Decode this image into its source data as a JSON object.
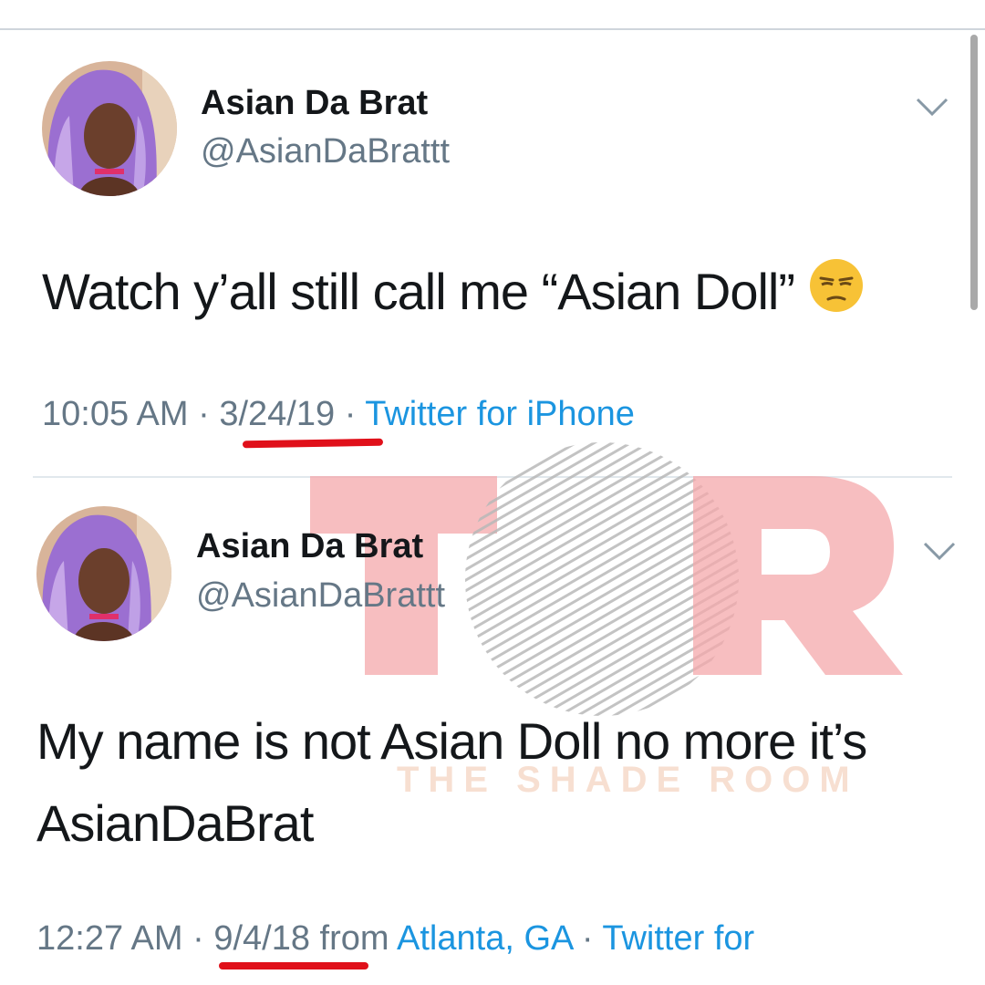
{
  "tweets": [
    {
      "name": "Asian Da Brat",
      "handle": "@AsianDaBrattt",
      "text": "Watch y’all still call me “Asian Doll”",
      "emoji_icon": "unamused-face-icon",
      "time": "10:05 AM",
      "sep1": " · ",
      "date": "3/24/19",
      "sep2": " · ",
      "source": "Twitter for iPhone"
    },
    {
      "name": "Asian Da Brat",
      "handle": "@AsianDaBrattt",
      "text_line1": "My name is not Asian Doll no more it’s",
      "text_line2": "AsianDaBrat",
      "time": "12:27 AM",
      "sep1": " · ",
      "date": "9/4/18",
      "from": " from ",
      "location": "Atlanta, GA",
      "sep2": " · ",
      "source": "Twitter for"
    }
  ],
  "watermark": {
    "logo": "TSR",
    "caption": "THE SHADE ROOM"
  },
  "colors": {
    "link": "#1b95e0",
    "secondary_text": "#657786",
    "underline": "#e0101a",
    "watermark_pink": "#f4a8ab"
  }
}
